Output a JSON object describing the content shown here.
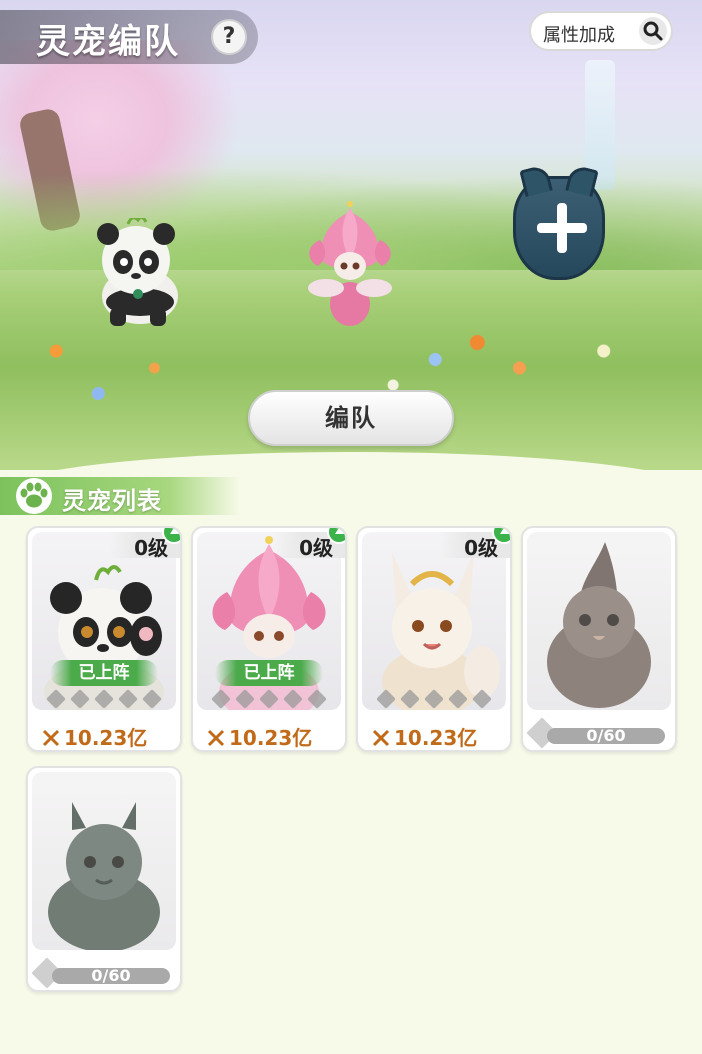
{
  "header": {
    "title": "灵宠编队",
    "help_label": "?",
    "bonus_button_label": "属性加成"
  },
  "formation": {
    "slots": [
      {
        "pet": "panda",
        "icon": "panda-pet"
      },
      {
        "pet": "lotus",
        "icon": "lotus-pet"
      },
      {
        "pet": "empty",
        "icon": "plus-icon"
      }
    ],
    "form_button_label": "编队"
  },
  "pet_list": {
    "title": "灵宠列表",
    "cards": [
      {
        "level": "0级",
        "deployed_label": "已上阵",
        "power": "10.23亿",
        "art": "panda",
        "stars": 5
      },
      {
        "level": "0级",
        "deployed_label": "已上阵",
        "power": "10.23亿",
        "art": "lotus-fairy",
        "stars": 5
      },
      {
        "level": "0级",
        "deployed_label": "",
        "power": "10.23亿",
        "art": "fox",
        "stars": 5
      },
      {
        "progress_text": "0/60",
        "art": "owl",
        "locked": true
      },
      {
        "progress_text": "0/60",
        "art": "dragon",
        "locked": true
      }
    ]
  },
  "colors": {
    "section_green": "#7cc25c",
    "power_orange": "#c06a1a",
    "upgrade_green": "#3cb34a",
    "deployed_green": "#4bab4b"
  }
}
